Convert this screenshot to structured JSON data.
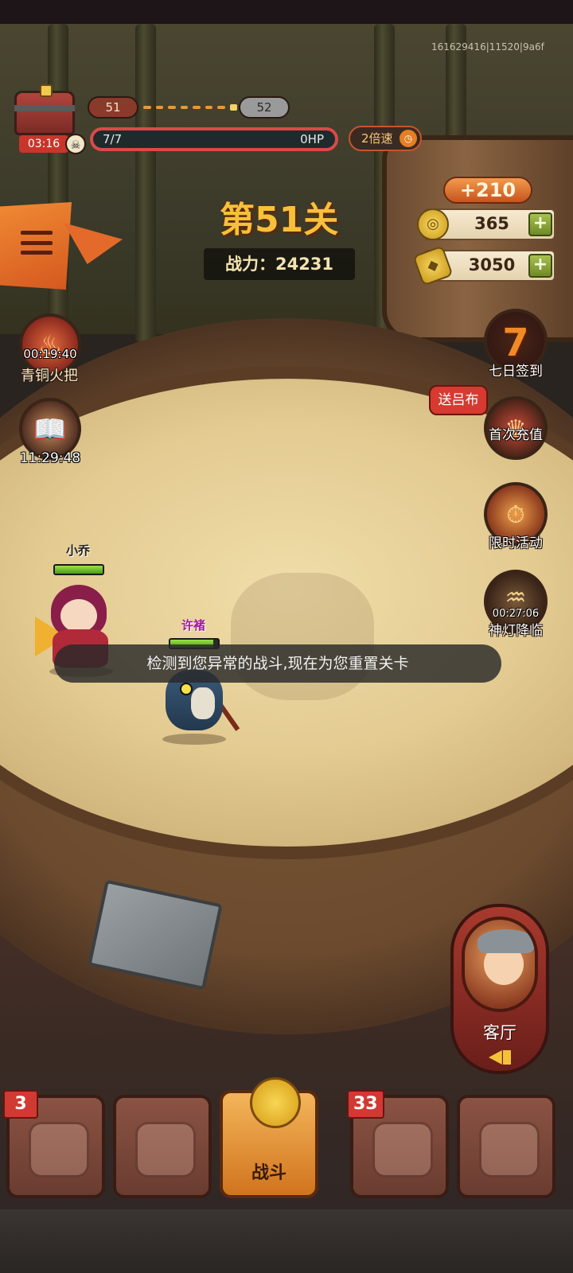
{
  "build_id": "161629416|11520|9a6f",
  "hud": {
    "chest_timer": "03:16",
    "level_current": "51",
    "level_next": "52",
    "hp_left": "7/7",
    "hp_right": "0HP",
    "speed_label": "2倍速"
  },
  "stage": {
    "title": "第51关",
    "power": "战力：24231"
  },
  "currency": {
    "bonus": "+210",
    "coins": "365",
    "ingots": "3050"
  },
  "left_features": [
    {
      "timer": "00:19:40",
      "label": "青铜火把"
    },
    {
      "timer": "11:29:48"
    }
  ],
  "right_events": [
    {
      "label": "七日签到"
    },
    {
      "label": "首次充值",
      "bubble": "送吕布"
    },
    {
      "label": "限时活动"
    },
    {
      "label": "神灯降临",
      "timer": "00:27:06"
    }
  ],
  "units": {
    "ally": {
      "name": "小乔",
      "hp_fraction": 1.0
    },
    "enemy": {
      "name": "许褚",
      "hp_fraction": 0.9
    }
  },
  "toast": "检测到您异常的战斗,现在为您重置关卡",
  "lobby": {
    "label": "客厅"
  },
  "nav": {
    "tabs": [
      {
        "id": "heroes",
        "badge": "3"
      },
      {
        "id": "armor"
      },
      {
        "id": "battle",
        "label": "战斗",
        "active": true
      },
      {
        "id": "chest",
        "badge": "33"
      },
      {
        "id": "map"
      }
    ]
  },
  "colors": {
    "stage_title": "#f6c03a",
    "hp_border": "#d94a4a",
    "badge": "#d13a33",
    "active_tab": "#e38f34"
  }
}
